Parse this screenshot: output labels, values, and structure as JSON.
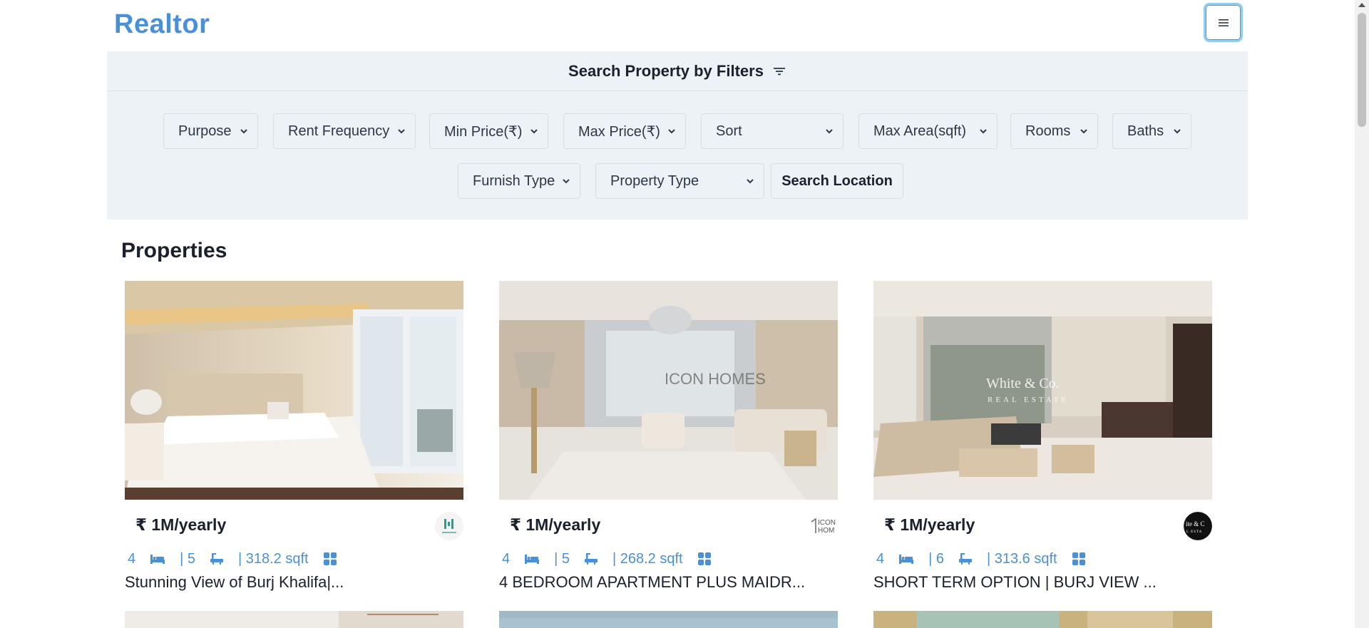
{
  "brand": {
    "name": "Realtor"
  },
  "header": {
    "menu_icon": "hamburger-icon"
  },
  "filters": {
    "title": "Search Property by Filters",
    "icon": "filter-lines-icon",
    "row1": [
      "Purpose",
      "Rent Frequency",
      "Min Price(₹)",
      "Max Price(₹)",
      "Sort",
      "Max Area(sqft)",
      "Rooms",
      "Baths"
    ],
    "row2": [
      "Furnish Type",
      "Property Type"
    ],
    "search_location": "Search Location"
  },
  "properties": {
    "heading": "Properties",
    "cards": [
      {
        "price": "₹ 1M/yearly",
        "rooms": "4",
        "baths": "| 5",
        "area": "| 318.2 sqft",
        "title": "Stunning View of Burj Khalifa|...",
        "agency": "agency-logo-teal"
      },
      {
        "price": "₹ 1M/yearly",
        "rooms": "4",
        "baths": "| 5",
        "area": "| 268.2 sqft",
        "title": "4 BEDROOM APARTMENT PLUS MAIDR...",
        "agency": "agency-logo-icon-homes"
      },
      {
        "price": "₹ 1M/yearly",
        "rooms": "4",
        "baths": "| 6",
        "area": "| 313.6 sqft",
        "title": "SHORT TERM OPTION | BURJ VIEW ...",
        "agency": "agency-logo-white-co"
      }
    ]
  },
  "watermarks": {
    "card2": "ICON HOMES",
    "card3": "White & Co.",
    "card3_sub": "REAL ESTATE"
  },
  "colors": {
    "accent": "#4a90d9",
    "panel": "#edf2f7"
  }
}
